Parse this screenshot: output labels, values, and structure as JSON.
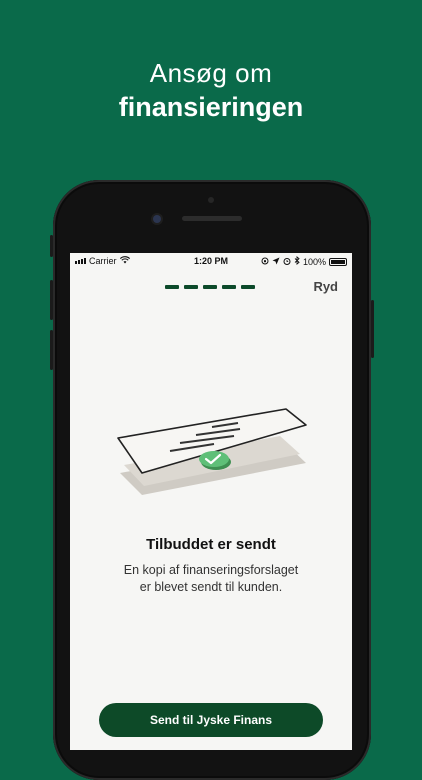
{
  "hero": {
    "line1": "Ansøg om",
    "line2": "finansieringen"
  },
  "status_bar": {
    "carrier": "Carrier",
    "time": "1:20 PM",
    "battery": "100%"
  },
  "header": {
    "progress_steps": 5,
    "clear_label": "Ryd"
  },
  "content": {
    "title": "Tilbuddet er sendt",
    "description_line1": "En kopi af finanseringsforslaget",
    "description_line2": "er blevet sendt til kunden."
  },
  "footer": {
    "button_label": "Send til Jyske Finans"
  },
  "colors": {
    "background": "#0a6a4a",
    "button": "#0d4a28",
    "progress": "#0c4a2a",
    "check_badge": "#5fbf78"
  }
}
